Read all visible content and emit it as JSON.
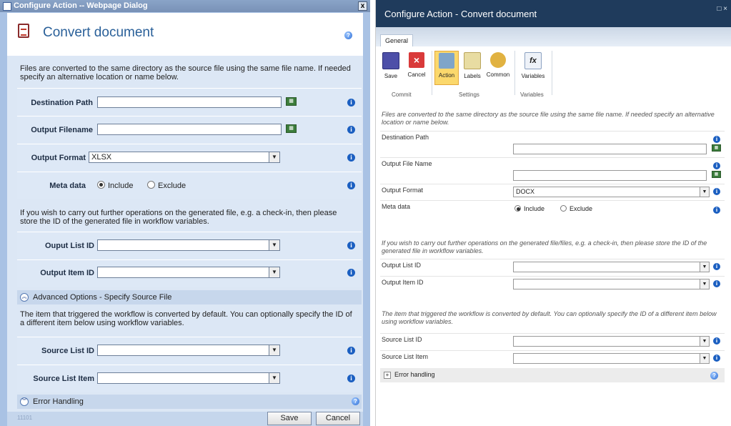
{
  "left": {
    "window_title": "Configure Action -- Webpage Dialog",
    "close_glyph": "x",
    "heading": "Convert document",
    "intro": "Files are converted to the same directory as the source file using the same file name. If needed specify an alternative location or name below.",
    "destination_label": "Destination Path",
    "destination_value": "",
    "output_filename_label": "Output Filename",
    "output_filename_value": "",
    "output_format_label": "Output Format",
    "output_format_value": "XLSX",
    "meta_label": "Meta data",
    "meta_include": "Include",
    "meta_exclude": "Exclude",
    "further_note": "If you wish to carry out further operations on the generated file, e.g. a check-in, then please store the ID of the generated file in workflow variables.",
    "output_list_id_label": "Ouput List ID",
    "output_item_id_label": "Output Item ID",
    "advanced_label": "Advanced Options - Specify Source File",
    "source_note": "The item that triggered the workflow is converted by default. You can optionally specify the ID of a different item below using workflow variables.",
    "source_list_id_label": "Source List ID",
    "source_list_item_label": "Source List Item",
    "error_handling_label": "Error Handling",
    "version": "11101",
    "save_label": "Save",
    "cancel_label": "Cancel"
  },
  "right": {
    "window_title": "Configure Action - Convert document",
    "window_controls": "□ ×",
    "tab_general": "General",
    "ribbon": {
      "save": "Save",
      "cancel": "Cancel",
      "action": "Action",
      "labels": "Labels",
      "common": "Common",
      "variables": "Variables",
      "group_commit": "Commit",
      "group_settings": "Settings",
      "group_variables": "Variables"
    },
    "intro": "Files are converted to the same directory as the source file using the same file name. If needed specify an alternative location or name below.",
    "destination_label": "Destination Path",
    "output_file_name_label": "Output File Name",
    "output_format_label": "Output Format",
    "output_format_value": "DOCX",
    "meta_label": "Meta data",
    "meta_include": "Include",
    "meta_exclude": "Exclude",
    "further_note": "If you wish to carry out further operations on the generated file/files, e.g. a check-in, then please store the ID of the generated file in workflow variables.",
    "output_list_id_label": "Output List ID",
    "output_item_id_label": "Output Item ID",
    "source_note": "The item that triggered the workflow is converted by default. You can optionally specify the ID of a different item below using workflow variables.",
    "source_list_id_label": "Source List ID",
    "source_list_item_label": "Source List Item",
    "error_handling_label": "Error handling"
  },
  "colors": {
    "left_frame": "#a9c2e4",
    "left_panel": "#dce7f5",
    "right_title": "#1f3b5c",
    "info_blue": "#1b5fc1",
    "ribbon_selected": "#fbd86c"
  }
}
